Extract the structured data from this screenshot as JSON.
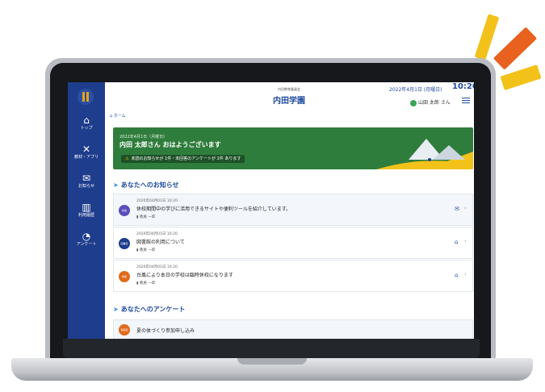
{
  "header": {
    "org": "内田教育委員会",
    "school": "内田学園",
    "date": "2022年4月1日 (月曜日)",
    "time": "10:20",
    "user": "山田 太郎 さん"
  },
  "breadcrumb": "ホーム",
  "sidebar": {
    "items": [
      {
        "label": "トップ",
        "icon": "home-icon",
        "glyph": "⌂"
      },
      {
        "label": "教材・アプリ",
        "icon": "tools-icon",
        "glyph": "✕"
      },
      {
        "label": "お知らせ",
        "icon": "mail-icon",
        "glyph": "✉"
      },
      {
        "label": "利用履歴",
        "icon": "bar-chart-icon",
        "glyph": "▥"
      },
      {
        "label": "アンケート",
        "icon": "pie-chart-icon",
        "glyph": "◔"
      }
    ]
  },
  "banner": {
    "date": "2022年4月1日（月曜日）",
    "greeting": "内田 太郎さん おはようございます",
    "notice": "未読のお知らせが 1件・未回答のアンケートが 1件 あります"
  },
  "notices": {
    "heading": "あなたへのお知らせ",
    "items": [
      {
        "avatar": "校長",
        "avatar_color": "#5a4fb8",
        "date": "2020年04月01日 10:20",
        "title": "休校期間中の学びに活用できるサイトや便利ツールを紹介しています。",
        "author": "教員 一郎",
        "status_icon": "mail-icon",
        "status_glyph": "✉"
      },
      {
        "avatar": "図書室",
        "avatar_color": "#1e3d8c",
        "date": "2020年04月01日 10:20",
        "title": "図書館の利用について",
        "author": "教員 一郎",
        "status_icon": "opened-mail-icon",
        "status_glyph": "⌂"
      },
      {
        "avatar": "教務",
        "avatar_color": "#e06a1c",
        "date": "2020年04月01日 10:20",
        "title": "台風により本日の学校は臨時休校になります",
        "author": "教員 一郎",
        "status_icon": "opened-mail-icon",
        "status_glyph": "⌂"
      }
    ]
  },
  "surveys": {
    "heading": "あなたへのアンケート",
    "items": [
      {
        "avatar": "保健室",
        "avatar_color": "#e06a1c",
        "title": "夏の体づくり参加申し込み"
      }
    ]
  }
}
